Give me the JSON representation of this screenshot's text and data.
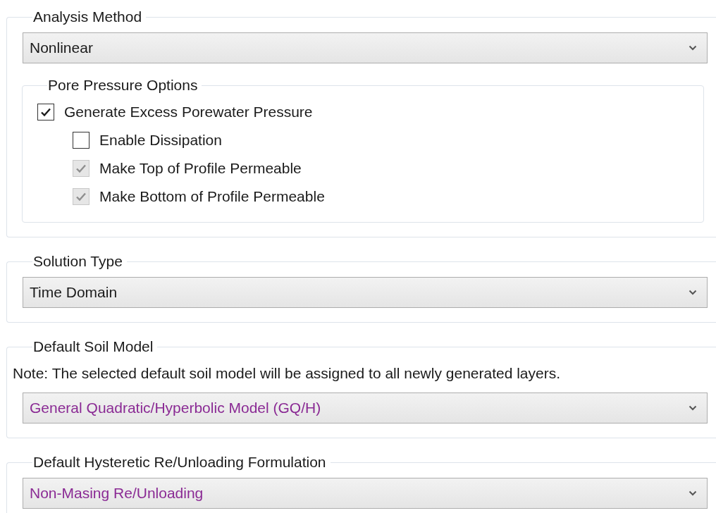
{
  "groups": [
    {
      "title": "Analysis Method",
      "dropdown": {
        "value": "Nonlinear",
        "color": "#1a1a1a"
      },
      "subgroup": {
        "title": "Pore Pressure Options",
        "options": [
          {
            "label": "Generate Excess Porewater Pressure",
            "checked": true,
            "disabled": false,
            "children": [
              {
                "label": "Enable Dissipation",
                "checked": false,
                "disabled": false
              },
              {
                "label": "Make Top of Profile Permeable",
                "checked": true,
                "disabled": true
              },
              {
                "label": "Make Bottom of Profile Permeable",
                "checked": true,
                "disabled": true
              }
            ]
          }
        ]
      }
    },
    {
      "title": "Solution Type",
      "dropdown": {
        "value": "Time Domain",
        "color": "#1a1a1a"
      }
    },
    {
      "title": "Default Soil Model",
      "note": "Note: The selected default soil model will be assigned to all newly generated layers.",
      "dropdown": {
        "value": "General Quadratic/Hyperbolic Model (GQ/H)",
        "color": "#8a2a94"
      }
    },
    {
      "title": "Default Hysteretic Re/Unloading Formulation",
      "dropdown": {
        "value": "Non-Masing Re/Unloading",
        "color": "#8a2a94"
      }
    }
  ]
}
